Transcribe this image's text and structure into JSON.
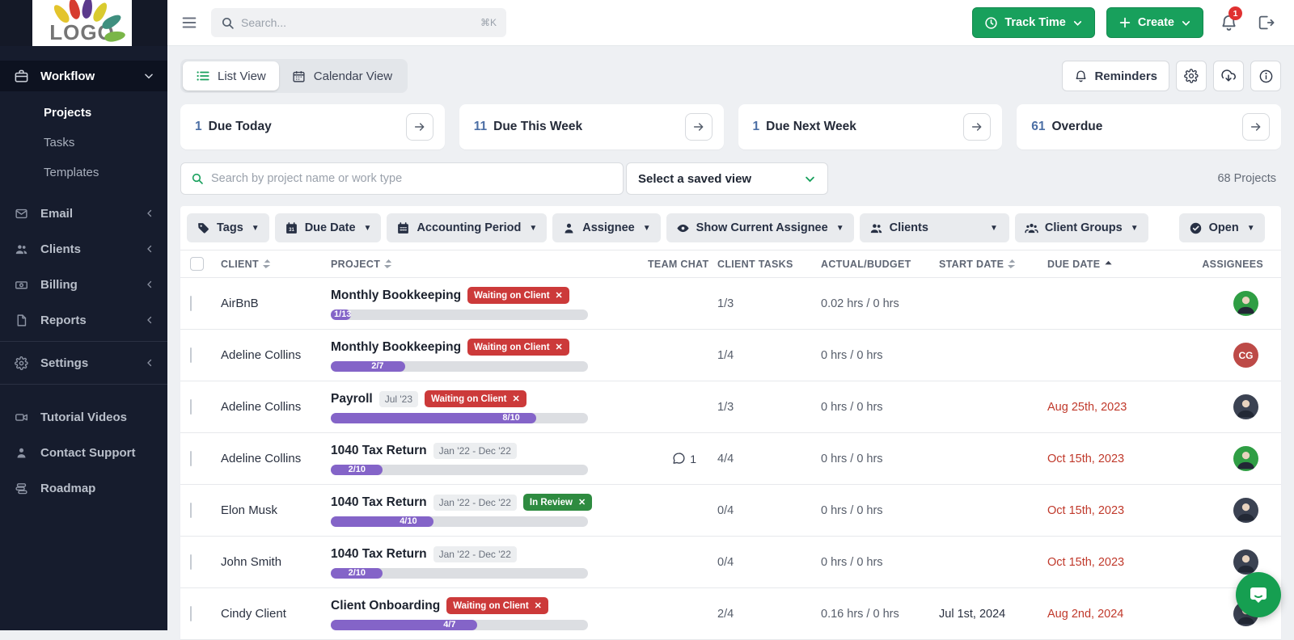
{
  "topbar": {
    "logo_text": "LOGO",
    "search_placeholder": "Search...",
    "search_shortcut": "⌘K",
    "track_time_label": "Track Time",
    "create_label": "Create",
    "notification_count": "1"
  },
  "sidebar": {
    "workflow": {
      "label": "Workflow",
      "icon": "briefcase"
    },
    "workflow_items": [
      {
        "label": "Projects",
        "active": true
      },
      {
        "label": "Tasks",
        "active": false
      },
      {
        "label": "Templates",
        "active": false
      }
    ],
    "items": [
      {
        "label": "Email",
        "icon": "mail"
      },
      {
        "label": "Clients",
        "icon": "users"
      },
      {
        "label": "Billing",
        "icon": "money"
      },
      {
        "label": "Reports",
        "icon": "file"
      },
      {
        "label": "Settings",
        "icon": "gear"
      }
    ],
    "footer_items": [
      {
        "label": "Tutorial Videos",
        "icon": "video"
      },
      {
        "label": "Contact Support",
        "icon": "person"
      },
      {
        "label": "Roadmap",
        "icon": "roadmap"
      }
    ]
  },
  "toolbar": {
    "tabs": [
      {
        "label": "List View",
        "icon": "list",
        "active": true
      },
      {
        "label": "Calendar View",
        "icon": "calendar",
        "active": false
      }
    ],
    "reminders_label": "Reminders"
  },
  "stats": [
    {
      "value": "1",
      "label": "Due Today"
    },
    {
      "value": "11",
      "label": "Due This Week"
    },
    {
      "value": "1",
      "label": "Due Next Week"
    },
    {
      "value": "61",
      "label": "Overdue"
    }
  ],
  "filters": {
    "search_placeholder": "Search by project name or work type",
    "saved_view_label": "Select a saved view",
    "projects_count": "68 Projects",
    "chips": [
      {
        "id": "tags",
        "label": "Tags",
        "icon": "tag",
        "caret": true
      },
      {
        "id": "due-date",
        "label": "Due Date",
        "icon": "cal31",
        "caret": true
      },
      {
        "id": "accounting",
        "label": "Accounting Period",
        "icon": "cal",
        "caret": true
      },
      {
        "id": "assignee",
        "label": "Assignee",
        "icon": "person",
        "caret": true
      },
      {
        "id": "show-assignee",
        "label": "Show Current Assignee",
        "icon": "eye",
        "caret": true
      },
      {
        "id": "clients",
        "label": "Clients",
        "icon": "users",
        "caret": true,
        "wide": true
      },
      {
        "id": "client-groups",
        "label": "Client Groups",
        "icon": "group",
        "caret": true
      },
      {
        "id": "open",
        "label": "Open",
        "icon": "check",
        "caret": true,
        "spacer_before": true
      }
    ]
  },
  "table": {
    "headers": [
      {
        "label": "CLIENT",
        "sort": "both"
      },
      {
        "label": "PROJECT",
        "sort": "both"
      },
      {
        "label": "TEAM CHAT",
        "sort": "none"
      },
      {
        "label": "CLIENT TASKS",
        "sort": "none"
      },
      {
        "label": "ACTUAL/BUDGET",
        "sort": "none"
      },
      {
        "label": "START DATE",
        "sort": "both"
      },
      {
        "label": "DUE DATE",
        "sort": "asc"
      },
      {
        "label": "ASSIGNEES",
        "sort": "none"
      }
    ],
    "rows": [
      {
        "client": "AirBnB",
        "project": "Monthly Bookkeeping",
        "period": "",
        "badge": {
          "label": "Waiting on Client",
          "color": "red"
        },
        "progress": "1/13",
        "chat": "",
        "tasks": "1/3",
        "budget": "0.02 hrs / 0 hrs",
        "start": "",
        "due": "",
        "avatar": {
          "type": "photo",
          "bg": "#2f9e44",
          "initials": ""
        }
      },
      {
        "client": "Adeline Collins",
        "project": "Monthly Bookkeeping",
        "period": "",
        "badge": {
          "label": "Waiting on Client",
          "color": "red"
        },
        "progress": "2/7",
        "chat": "",
        "tasks": "1/4",
        "budget": "0 hrs / 0 hrs",
        "start": "",
        "due": "",
        "avatar": {
          "type": "initials",
          "bg": "#bd4a47",
          "initials": "CG"
        }
      },
      {
        "client": "Adeline Collins",
        "project": "Payroll",
        "period": "Jul '23",
        "badge": {
          "label": "Waiting on Client",
          "color": "red"
        },
        "progress": "8/10",
        "chat": "",
        "tasks": "1/3",
        "budget": "0 hrs / 0 hrs",
        "start": "",
        "due": "Aug 25th, 2023",
        "avatar": {
          "type": "photo",
          "bg": "#3b4252",
          "initials": ""
        }
      },
      {
        "client": "Adeline Collins",
        "project": "1040 Tax Return",
        "period": "Jan '22 - Dec '22",
        "badge": null,
        "progress": "2/10",
        "chat": "1",
        "tasks": "4/4",
        "budget": "0 hrs / 0 hrs",
        "start": "",
        "due": "Oct 15th, 2023",
        "avatar": {
          "type": "photo",
          "bg": "#2f9e44",
          "initials": ""
        }
      },
      {
        "client": "Elon Musk",
        "project": "1040 Tax Return",
        "period": "Jan '22 - Dec '22",
        "badge": {
          "label": "In Review",
          "color": "green"
        },
        "progress": "4/10",
        "chat": "",
        "tasks": "0/4",
        "budget": "0 hrs / 0 hrs",
        "start": "",
        "due": "Oct 15th, 2023",
        "avatar": {
          "type": "photo",
          "bg": "#3b4252",
          "initials": ""
        }
      },
      {
        "client": "John Smith",
        "project": "1040 Tax Return",
        "period": "Jan '22 - Dec '22",
        "badge": null,
        "progress": "2/10",
        "chat": "",
        "tasks": "0/4",
        "budget": "0 hrs / 0 hrs",
        "start": "",
        "due": "Oct 15th, 2023",
        "avatar": {
          "type": "photo",
          "bg": "#3b4252",
          "initials": ""
        }
      },
      {
        "client": "Cindy Client",
        "project": "Client Onboarding",
        "period": "",
        "badge": {
          "label": "Waiting on Client",
          "color": "red"
        },
        "progress": "4/7",
        "chat": "",
        "tasks": "2/4",
        "budget": "0.16 hrs / 0 hrs",
        "start": "Jul 1st, 2024",
        "due": "Aug 2nd, 2024",
        "avatar": {
          "type": "photo",
          "bg": "#3b4252",
          "initials": ""
        }
      }
    ]
  },
  "colors": {
    "accent_green": "#18a05c",
    "badge_red": "#cc3a3a",
    "badge_green": "#2e8b40",
    "progress_purple": "#8464c8",
    "overdue_red": "#c0392b",
    "stat_blue": "#4c6fa5",
    "sidebar_navy": "#161c2d"
  }
}
